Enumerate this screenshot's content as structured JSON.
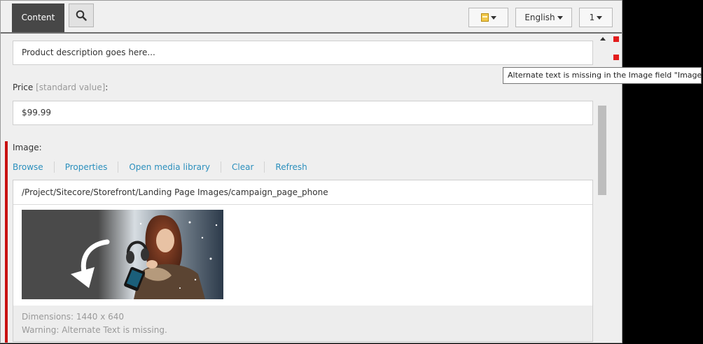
{
  "header": {
    "content_tab": "Content",
    "language": "English",
    "version": "1"
  },
  "fields": {
    "description_value": "Product description goes here...",
    "price_label": "Price",
    "price_standard": "[standard value]",
    "price_colon": ":",
    "price_value": "$99.99",
    "image_label": "Image:",
    "image_links": [
      "Browse",
      "Properties",
      "Open media library",
      "Clear",
      "Refresh"
    ],
    "image_path": "/Project/Sitecore/Storefront/Landing Page Images/campaign_page_phone",
    "dimensions": "Dimensions: 1440 x 640",
    "warning": "Warning: Alternate Text is missing."
  },
  "tooltip": "Alternate text is missing in the Image field \"Image\".",
  "colors": {
    "tab_active": "#474747",
    "link": "#2b8fbd",
    "error": "#e21c1c",
    "required_bar": "#c81010"
  },
  "icons": [
    "search-icon",
    "database-icon",
    "chevron-down-icon",
    "scroll-up-icon",
    "validation-error-icon"
  ]
}
